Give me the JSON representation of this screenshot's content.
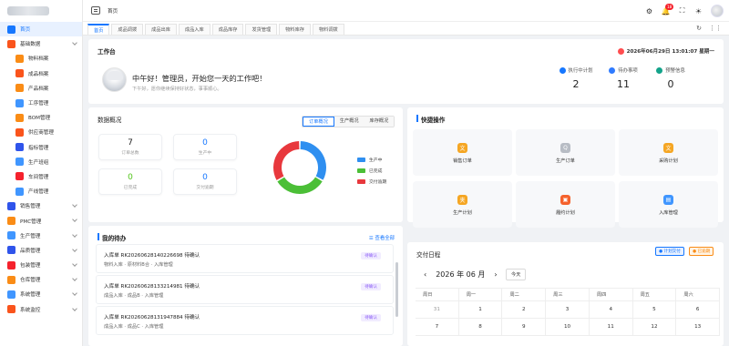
{
  "topbar": {
    "breadcrumb": "首页",
    "notif_count": "18"
  },
  "sidebar": {
    "items": [
      {
        "label": "首页",
        "color": "#1677ff",
        "active": true,
        "sub": false
      },
      {
        "label": "基础数据",
        "color": "#fa541c",
        "sub": false,
        "caret": true
      },
      {
        "label": "物料档案",
        "color": "#fa8c16",
        "sub": true
      },
      {
        "label": "成品档案",
        "color": "#fa541c",
        "sub": true
      },
      {
        "label": "产品档案",
        "color": "#fa8c16",
        "sub": true
      },
      {
        "label": "工序管理",
        "color": "#4096ff",
        "sub": true
      },
      {
        "label": "BOM管理",
        "color": "#fa8c16",
        "sub": true
      },
      {
        "label": "供应商管理",
        "color": "#fa541c",
        "sub": true
      },
      {
        "label": "指标管理",
        "color": "#2f54eb",
        "sub": true
      },
      {
        "label": "生产班组",
        "color": "#4096ff",
        "sub": true
      },
      {
        "label": "车间管理",
        "color": "#f5222d",
        "sub": true
      },
      {
        "label": "产线管理",
        "color": "#4096ff",
        "sub": true
      },
      {
        "label": "销售管理",
        "color": "#2f54eb",
        "sub": false,
        "caret": true
      },
      {
        "label": "PMC管理",
        "color": "#fa8c16",
        "sub": false,
        "caret": true
      },
      {
        "label": "生产管理",
        "color": "#4096ff",
        "sub": false,
        "caret": true
      },
      {
        "label": "品质管理",
        "color": "#2f54eb",
        "sub": false,
        "caret": true
      },
      {
        "label": "包装管理",
        "color": "#f5222d",
        "sub": false,
        "caret": true
      },
      {
        "label": "仓库管理",
        "color": "#fa8c16",
        "sub": false,
        "caret": true
      },
      {
        "label": "系统管理",
        "color": "#4096ff",
        "sub": false,
        "caret": true
      },
      {
        "label": "系统监控",
        "color": "#fa541c",
        "sub": false,
        "caret": true
      }
    ]
  },
  "tabs": [
    "首页",
    "成品调拨",
    "成品出库",
    "成品入库",
    "成品库存",
    "发货管理",
    "物料库存",
    "物料调拨"
  ],
  "workbench": {
    "title": "工作台",
    "datetime": "2026年06月29日 13:01:07 星期一",
    "greeting": "中午好！管理员，开始您一天的工作吧！",
    "subtext": "下午好，愿你继续保持好状态，事事顺心。",
    "stats": [
      {
        "label": "执行中计划",
        "value": "2",
        "color": "#1677ff"
      },
      {
        "label": "待办事项",
        "value": "11",
        "color": "#2f7bff"
      },
      {
        "label": "预警信息",
        "value": "0",
        "color": "#13a38a"
      }
    ]
  },
  "overview": {
    "title": "数据概况",
    "segments": [
      "订单概况",
      "生产概况",
      "库存概况"
    ],
    "cards": [
      {
        "value": "7",
        "label": "订单总数",
        "color": "#222"
      },
      {
        "value": "0",
        "label": "生产中",
        "color": "#1677ff"
      },
      {
        "value": "0",
        "label": "已完成",
        "color": "#52c41a"
      },
      {
        "value": "0",
        "label": "交付逾期",
        "color": "#1677ff"
      }
    ],
    "legend": [
      {
        "label": "生产中",
        "color": "#2f8ff0"
      },
      {
        "label": "已完成",
        "color": "#4bbf37"
      },
      {
        "label": "交付逾期",
        "color": "#e8383d"
      }
    ]
  },
  "chart_data": {
    "type": "pie",
    "labels": [
      "生产中",
      "已完成",
      "交付逾期"
    ],
    "values": [
      33.3,
      33.3,
      33.4
    ],
    "colors": [
      "#2f8ff0",
      "#4bbf37",
      "#e8383d"
    ]
  },
  "quick": {
    "title": "快捷操作",
    "items": [
      {
        "label": "销售订单",
        "color": "#f5a623",
        "icon": "文"
      },
      {
        "label": "生产订单",
        "color": "#b7bcc4",
        "icon": "Q"
      },
      {
        "label": "采购计划",
        "color": "#f5a623",
        "icon": "文"
      },
      {
        "label": "生产计划",
        "color": "#f5a623",
        "icon": "夹"
      },
      {
        "label": "履约计划",
        "color": "#f5622d",
        "icon": "▣"
      },
      {
        "label": "入库管理",
        "color": "#4096ff",
        "icon": "▤"
      }
    ]
  },
  "todos": {
    "title": "我的待办",
    "see_all": "查看全部",
    "items": [
      {
        "title": "入库单 RK20260628140226698 待确认",
        "desc": "物料入库 · 原材料B合 · 入库管理",
        "badge": "待确认"
      },
      {
        "title": "入库单 RK20260628133214981 待确认",
        "desc": "成品入库 · 成品B · 入库管理",
        "badge": "待确认"
      },
      {
        "title": "入库单 RK20260628131947884 待确认",
        "desc": "成品入库 · 成品C · 入库管理",
        "badge": "待确认"
      }
    ]
  },
  "calendar": {
    "title": "交付日程",
    "legend": [
      {
        "label": "计划交付",
        "color": "#1677ff",
        "bg": "#e8f1ff"
      },
      {
        "label": "已逾期",
        "color": "#fa8c16",
        "bg": "#fff4e5"
      }
    ],
    "month_label": "2026 年 06 月",
    "today_label": "今天",
    "weekdays": [
      "周日",
      "周一",
      "周二",
      "周三",
      "周四",
      "周五",
      "周六"
    ],
    "rows": [
      [
        "31",
        "1",
        "2",
        "3",
        "4",
        "5",
        "6"
      ],
      [
        "7",
        "8",
        "9",
        "10",
        "11",
        "12",
        "13"
      ]
    ]
  }
}
